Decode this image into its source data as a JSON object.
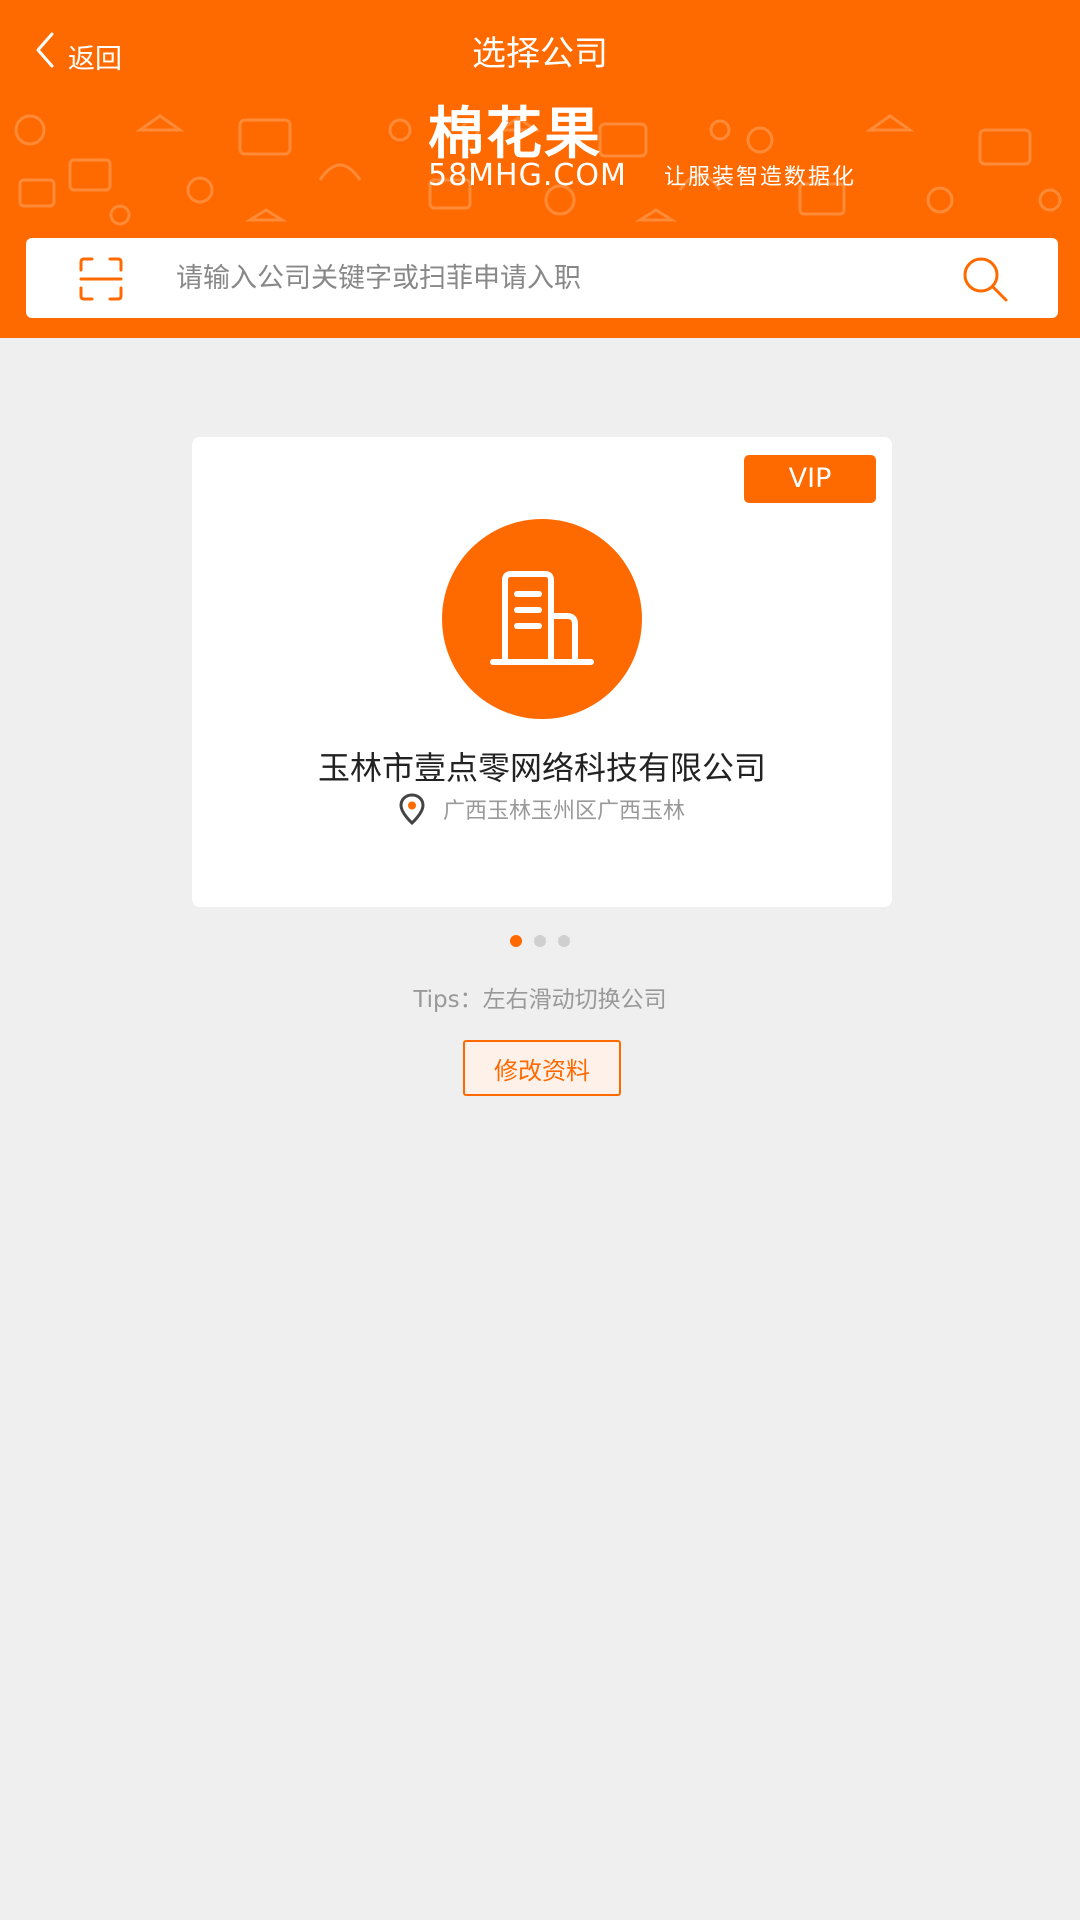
{
  "header": {
    "back_label": "返回",
    "title": "选择公司",
    "brand": {
      "name": "棉花果",
      "domain": "58MHG.COM",
      "slogan": "让服装智造数据化"
    },
    "background_color": "#ff6a00"
  },
  "search": {
    "placeholder": "请输入公司关键字或扫菲申请入职",
    "value": "",
    "scan_icon": "scan-frame-icon",
    "search_icon": "magnifier-icon"
  },
  "company_card": {
    "badge": "VIP",
    "logo_icon": "building-icon",
    "name": "玉林市壹点零网络科技有限公司",
    "location_icon": "map-pin-icon",
    "address": "广西玉林玉州区广西玉林"
  },
  "pagination": {
    "total": 3,
    "active_index": 0
  },
  "tips": "Tips：左右滑动切换公司",
  "edit_button_label": "修改资料",
  "colors": {
    "accent": "#ff6a00",
    "page_bg": "#efefef",
    "muted_text": "#999999"
  }
}
